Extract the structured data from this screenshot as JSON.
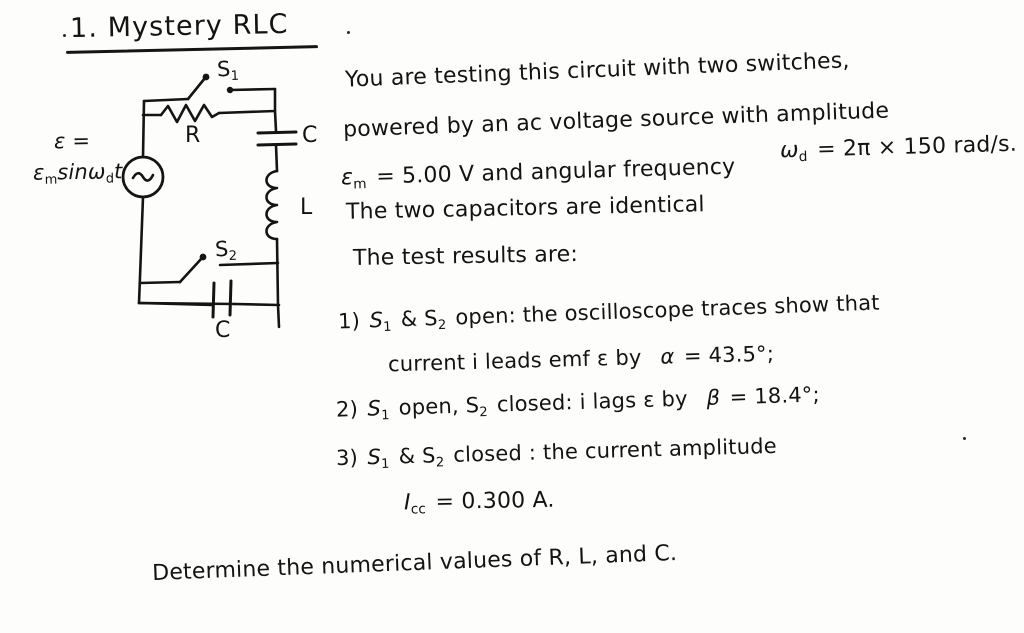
{
  "page": {
    "title": "1. Mystery RLC",
    "ink_color": "#131313",
    "paper_color": "#fdfdfc"
  },
  "circuit": {
    "source_label_line1": "ε =",
    "source_label_line2_main": "ε",
    "source_label_line2_sub": "m",
    "source_label_line2_rest": "sinω",
    "source_label_line2_sub2": "d",
    "source_label_line2_tail": "t",
    "source_symbol": "~",
    "switch1_label": "S",
    "switch1_sub": "1",
    "switch2_label": "S",
    "switch2_sub": "2",
    "resistor_label": "R",
    "capacitor_top_label": "C",
    "capacitor_bottom_label": "C",
    "inductor_label": "L"
  },
  "problem": {
    "line1": "You are testing this circuit with two switches,",
    "line2": "powered by an  ac voltage source  with amplitude",
    "line3_a": "ε",
    "line3_sub": "m",
    "line3_b": "= 5.00 V and angular frequency",
    "line3_c_main": "ω",
    "line3_c_sub": "d",
    "line3_c_rest": "= 2π × 150 rad/s.",
    "line4": "The two  capacitors  are  identical",
    "line5": "The test results are:"
  },
  "results": [
    {
      "number": "1)",
      "text_a": "S",
      "sub_a": "1",
      "text_b": "& S",
      "sub_b": "2",
      "text_c": "open: the oscilloscope traces show that",
      "cont": "current i leads emf ε by",
      "symbol": "α",
      "value": "= 43.5°;"
    },
    {
      "number": "2)",
      "text_a": "S",
      "sub_a": "1",
      "text_b": "open, S",
      "sub_b": "2",
      "text_c": "closed:  i lags ε by",
      "symbol": "β",
      "value": "= 18.4°;"
    },
    {
      "number": "3)",
      "text_a": "S",
      "sub_a": "1",
      "text_b": "& S",
      "sub_b": "2",
      "text_c": "closed : the current amplitude",
      "cont_symbol": "I",
      "cont_sub": "cc",
      "cont_value": "= 0.300 A."
    }
  ],
  "footer": {
    "question": "Determine the numerical values of  R, L, and C."
  }
}
